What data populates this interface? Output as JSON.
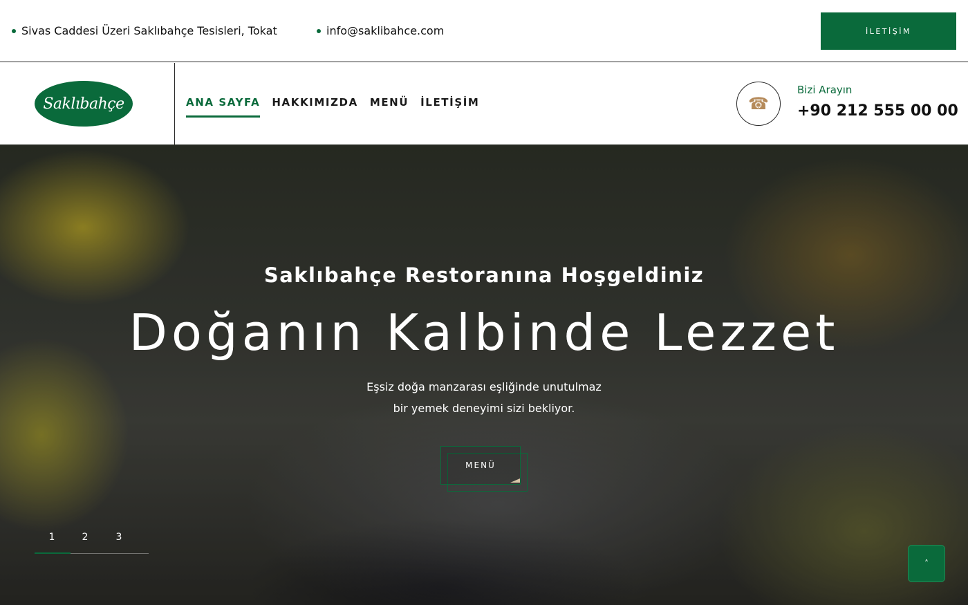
{
  "topbar": {
    "address": "Sivas Caddesi Üzeri Saklıbahçe Tesisleri, Tokat",
    "email": "info@saklibahce.com",
    "cta_label": "İLETİŞİM"
  },
  "header": {
    "logo_text": "Saklıbahçe",
    "nav": [
      {
        "label": "ANA SAYFA",
        "active": true
      },
      {
        "label": "HAKKIMIZDA",
        "active": false
      },
      {
        "label": "MENÜ",
        "active": false
      },
      {
        "label": "İLETİŞİM",
        "active": false
      }
    ],
    "phone_icon": "phone-icon",
    "call_label": "Bizi Arayın",
    "call_number": "+90 212 555 00 00"
  },
  "hero": {
    "subtitle": "Saklıbahçe Restoranına Hoşgeldiniz",
    "title": "Doğanın Kalbinde Lezzet",
    "text_line1": "Eşsiz doğa manzarası eşliğinde unutulmaz",
    "text_line2": "bir yemek deneyimi sizi bekliyor.",
    "button_label": "MENÜ",
    "slides": [
      "1",
      "2",
      "3"
    ],
    "active_slide": 1
  },
  "back_to_top_icon": "chevron-up-icon",
  "colors": {
    "brand_green": "#0a6a3b",
    "accent_tan": "#b58a5a"
  }
}
